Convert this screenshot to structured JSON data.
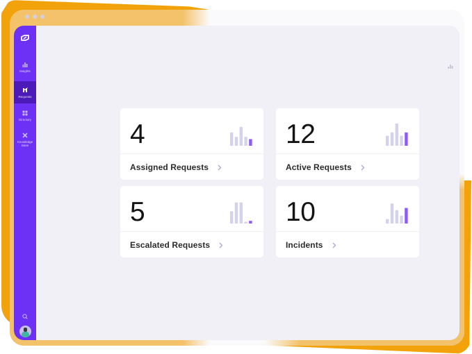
{
  "window": {
    "controls": [
      "close",
      "minimize",
      "maximize"
    ]
  },
  "colors": {
    "sidebar": "#6c31f5",
    "sidebar_active": "#4b1ab8",
    "accent_bar": "#8b5cf6",
    "muted_bar": "#d4d3ea",
    "background": "#f1f0f6",
    "decoration": "#f2a20a"
  },
  "sidebar": {
    "logo": "brand-logo-icon",
    "items": [
      {
        "label": "Insights",
        "icon": "bar-chart-icon",
        "active": false
      },
      {
        "label": "Requests",
        "icon": "requests-icon",
        "active": true
      },
      {
        "label": "Directory",
        "icon": "grid-icon",
        "active": false
      },
      {
        "label": "Knowledge Base",
        "icon": "knowledge-icon",
        "active": false
      }
    ],
    "search_icon": "search-icon",
    "avatar": "user-avatar"
  },
  "header": {
    "chart_icon": "bar-chart-icon"
  },
  "cards": [
    {
      "value": "4",
      "label": "Assigned Requests",
      "trend": [
        0.6,
        0.4,
        0.85,
        0.4,
        0.3
      ]
    },
    {
      "value": "12",
      "label": "Active Requests",
      "trend": [
        0.45,
        0.6,
        1.0,
        0.45,
        0.6
      ]
    },
    {
      "value": "5",
      "label": "Escalated Requests",
      "trend": [
        0.55,
        0.95,
        0.95,
        0.08,
        0.12
      ]
    },
    {
      "value": "10",
      "label": "Incidents",
      "trend": [
        0.2,
        0.9,
        0.6,
        0.35,
        0.7
      ]
    }
  ]
}
